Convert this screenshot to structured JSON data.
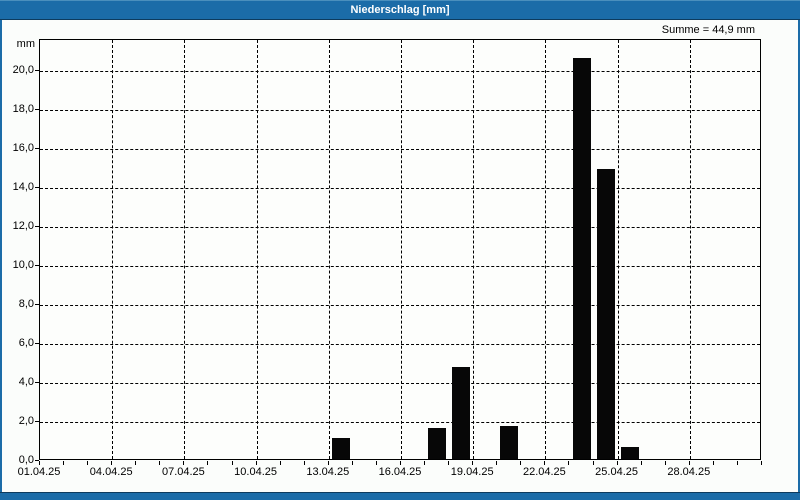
{
  "window": {
    "title": "Niederschlag [mm]"
  },
  "summary": {
    "label": "Summe = 44,9 mm"
  },
  "colors": {
    "titlebar_blue": "#1b6ca8",
    "titlebar_edge_dark": "#0d3b5e",
    "bar_black": "#070707",
    "background": "#fbfdfb",
    "plot_background": "#fdfefc",
    "grid": "#000000",
    "title_text": "#ffffff"
  },
  "chart_data": {
    "type": "bar",
    "title": "Niederschlag [mm]",
    "unit_label": "mm",
    "sum_annotation": "Summe = 44,9 mm",
    "grid": "dashed",
    "legend": "none",
    "ylim": [
      0,
      21.6
    ],
    "y_ticks": [
      {
        "value": 0,
        "label": "0,0"
      },
      {
        "value": 2,
        "label": "2,0"
      },
      {
        "value": 4,
        "label": "4,0"
      },
      {
        "value": 6,
        "label": "6,0"
      },
      {
        "value": 8,
        "label": "8,0"
      },
      {
        "value": 10,
        "label": "10,0"
      },
      {
        "value": 12,
        "label": "12,0"
      },
      {
        "value": 14,
        "label": "14,0"
      },
      {
        "value": 16,
        "label": "16,0"
      },
      {
        "value": 18,
        "label": "18,0"
      },
      {
        "value": 20,
        "label": "20,0"
      }
    ],
    "x_range_days": [
      1,
      31
    ],
    "x_minor_tick_every_days": 1,
    "x_labels": [
      {
        "day": 1,
        "label": "01.04.25"
      },
      {
        "day": 4,
        "label": "04.04.25"
      },
      {
        "day": 7,
        "label": "07.04.25"
      },
      {
        "day": 10,
        "label": "10.04.25"
      },
      {
        "day": 13,
        "label": "13.04.25"
      },
      {
        "day": 16,
        "label": "16.04.25"
      },
      {
        "day": 19,
        "label": "19.04.25"
      },
      {
        "day": 22,
        "label": "22.04.25"
      },
      {
        "day": 25,
        "label": "25.04.25"
      },
      {
        "day": 28,
        "label": "28.04.25"
      }
    ],
    "bars": [
      {
        "date": "13.04.25",
        "day": 13,
        "value": 1.1
      },
      {
        "date": "17.04.25",
        "day": 17,
        "value": 1.6
      },
      {
        "date": "18.04.25",
        "day": 18,
        "value": 4.7
      },
      {
        "date": "20.04.25",
        "day": 20,
        "value": 1.7
      },
      {
        "date": "23.04.25",
        "day": 23,
        "value": 20.6
      },
      {
        "date": "24.04.25",
        "day": 24,
        "value": 14.9
      },
      {
        "date": "25.04.25",
        "day": 25,
        "value": 0.6
      }
    ]
  }
}
